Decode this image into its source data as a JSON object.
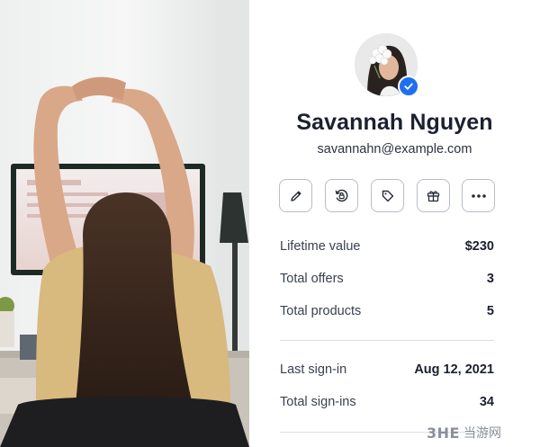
{
  "photo": {
    "alt_icon": "woman-stretching-at-desk-photo"
  },
  "profile": {
    "name": "Savannah Nguyen",
    "email": "savannahn@example.com",
    "avatar_icon": "avatar-portrait",
    "verified_icon": "verified-check-icon"
  },
  "actions": [
    {
      "icon": "pencil-icon"
    },
    {
      "icon": "refresh-lock-icon"
    },
    {
      "icon": "tag-icon"
    },
    {
      "icon": "gift-icon"
    },
    {
      "icon": "more-icon"
    }
  ],
  "stats": [
    {
      "label": "Lifetime value",
      "value": "$230"
    },
    {
      "label": "Total offers",
      "value": "3"
    },
    {
      "label": "Total products",
      "value": "5"
    }
  ],
  "activity": [
    {
      "label": "Last sign-in",
      "value": "Aug 12, 2021"
    },
    {
      "label": "Total sign-ins",
      "value": "34"
    }
  ],
  "watermark": {
    "logo": "3HE",
    "text": "当游网"
  },
  "colors": {
    "accent": "#1f6ff0",
    "border": "#b9bdc6",
    "text": "#1c2030",
    "muted": "#3a4050"
  }
}
